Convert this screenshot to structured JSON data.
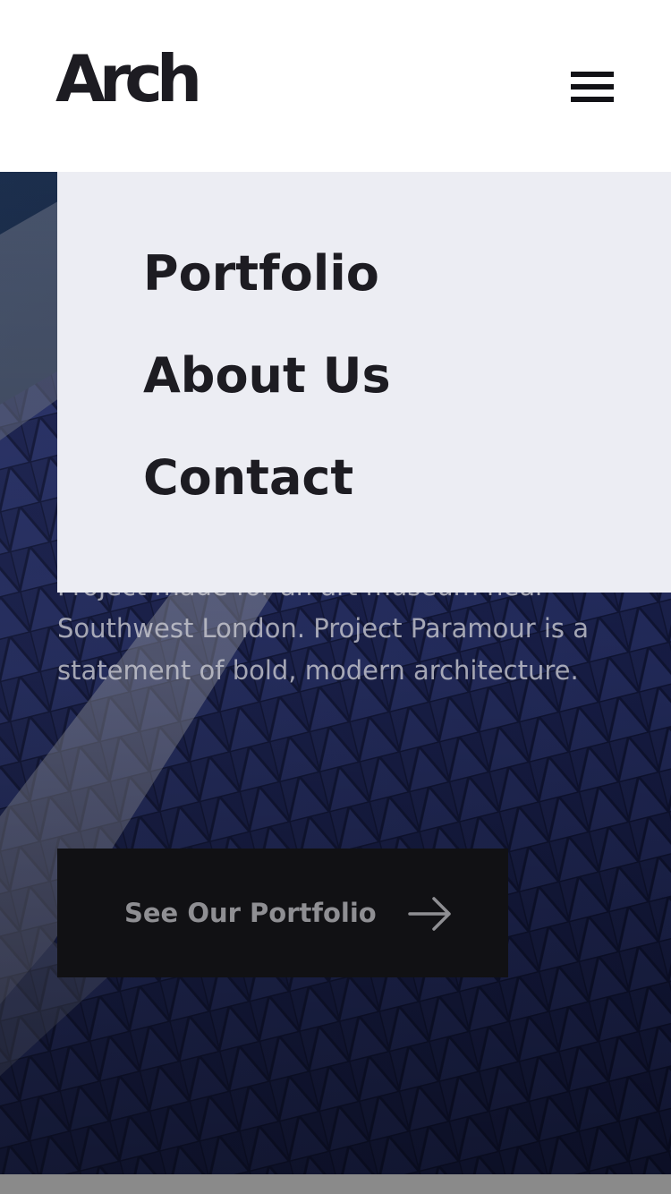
{
  "header": {
    "logo_text": "Arch",
    "menu_icon": "hamburger-menu-icon"
  },
  "nav": {
    "items": [
      {
        "label": "Portfolio"
      },
      {
        "label": "About Us"
      },
      {
        "label": "Contact"
      }
    ]
  },
  "hero": {
    "description": "Project made for an art museum near Southwest London. Project Paramour is a statement of bold, modern architecture.",
    "cta_label": "See Our Portfolio",
    "cta_icon": "arrow-right-icon",
    "image": "building-facade-image"
  },
  "colors": {
    "text_dark": "#1d1c22",
    "panel_bg": "#ecedf3",
    "button_bg": "#111114",
    "hero_blue": "#1f2a5c"
  }
}
